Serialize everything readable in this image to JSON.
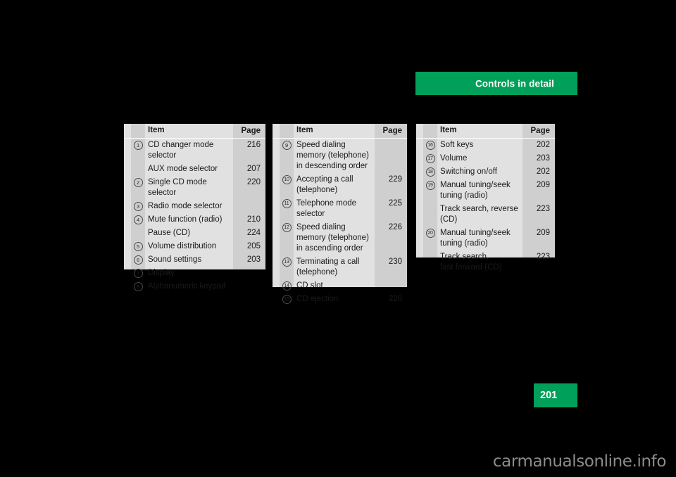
{
  "header": {
    "chapter_title": "Controls in detail",
    "accent_color": "#00a05a"
  },
  "footer": {
    "page_number": "201",
    "watermark": "carmanualsonline.info"
  },
  "columns": {
    "item": "Item",
    "page": "Page"
  },
  "tables": [
    {
      "id": "table-1",
      "rows": [
        {
          "num": "1",
          "item": "CD changer mode selector",
          "page": "216"
        },
        {
          "num": "",
          "item": "AUX mode selector",
          "page": "207"
        },
        {
          "num": "2",
          "item": "Single CD mode selector",
          "page": "220"
        },
        {
          "num": "3",
          "item": "Radio mode selector",
          "page": ""
        },
        {
          "num": "4",
          "item": "Mute function (radio)",
          "page": "210"
        },
        {
          "num": "",
          "item": "Pause (CD)",
          "page": "224"
        },
        {
          "num": "5",
          "item": "Volume distribution",
          "page": "205"
        },
        {
          "num": "6",
          "item": "Sound settings",
          "page": "203"
        },
        {
          "num": "7",
          "item": "Display",
          "page": ""
        },
        {
          "num": "8",
          "item": "Alphanumeric keypad",
          "page": ""
        }
      ]
    },
    {
      "id": "table-2",
      "rows": [
        {
          "num": "9",
          "item": "Speed dialing memory (telephone) in descending order",
          "page": ""
        },
        {
          "num": "10",
          "item": "Accepting a call (telephone)",
          "page": "229"
        },
        {
          "num": "11",
          "item": "Telephone mode selector",
          "page": "225"
        },
        {
          "num": "12",
          "item": "Speed dialing memory (telephone) in ascending order",
          "page": "226"
        },
        {
          "num": "13",
          "item": "Terminating a call (telephone)",
          "page": "230"
        },
        {
          "num": "14",
          "item": "CD slot",
          "page": ""
        },
        {
          "num": "15",
          "item": "CD ejection",
          "page": "220"
        }
      ]
    },
    {
      "id": "table-3",
      "rows": [
        {
          "num": "16",
          "item": "Soft keys",
          "page": "202"
        },
        {
          "num": "17",
          "item": "Volume",
          "page": "203"
        },
        {
          "num": "18",
          "item": "Switching on/off",
          "page": "202"
        },
        {
          "num": "19",
          "item": "Manual tuning/seek tuning (radio)",
          "page": "209"
        },
        {
          "num": "",
          "item": "Track search, reverse (CD)",
          "page": "223"
        },
        {
          "num": "20",
          "item": "Manual tuning/seek tuning (radio)",
          "page": "209"
        },
        {
          "num": "",
          "item": "Track search,\nfast forward (CD)",
          "page": "223"
        }
      ]
    }
  ]
}
